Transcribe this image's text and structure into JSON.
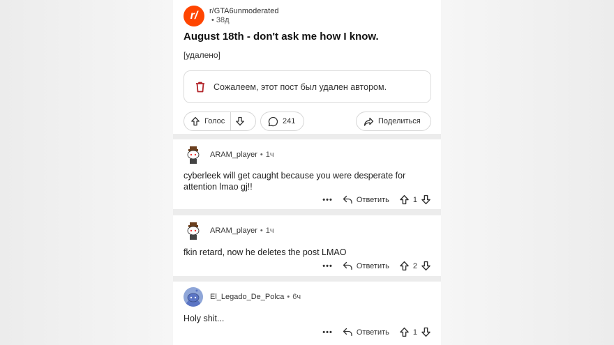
{
  "post": {
    "subreddit": "r/GTA6unmoderated",
    "age": "• 38д",
    "title": "August 18th - don't ask me how I know.",
    "removed_label": "[удалено]",
    "deleted_message": "Сожалеем, этот пост был удален автором.",
    "vote_label": "Голос",
    "comment_count": "241",
    "share_label": "Поделиться",
    "icon_text": "r/"
  },
  "comments": [
    {
      "user": "ARAM_player",
      "dot": "•",
      "age": "1ч",
      "text": "cyberleek will get caught because you were desperate for attention lmao gj!!",
      "more": "•••",
      "reply_label": "Ответить",
      "score": "1"
    },
    {
      "user": "ARAM_player",
      "dot": "•",
      "age": "1ч",
      "text": "fkin retard, now he deletes the post LMAO",
      "more": "•••",
      "reply_label": "Ответить",
      "score": "2"
    },
    {
      "user": "El_Legado_De_Polca",
      "dot": "•",
      "age": "6ч",
      "text": "Holy shit...",
      "more": "•••",
      "reply_label": "Ответить",
      "score": "1"
    }
  ],
  "colors": {
    "accent": "#ff4500",
    "trash": "#b3262b"
  }
}
